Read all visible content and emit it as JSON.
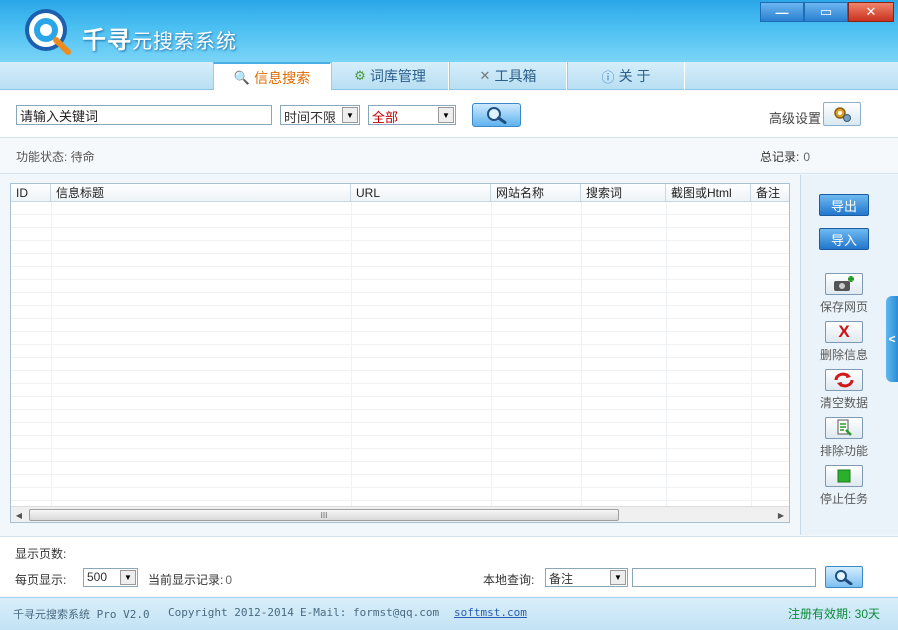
{
  "app": {
    "title_main": "千寻",
    "title_rest": "元搜索系统",
    "accent": "#2aa6e8"
  },
  "window_controls": {
    "minimize": "—",
    "maximize": "▭",
    "close": "✕"
  },
  "tabs": [
    {
      "label": "信息搜索",
      "icon": "search-icon",
      "active": true
    },
    {
      "label": "词库管理",
      "icon": "dictionary-icon",
      "active": false
    },
    {
      "label": "工具箱",
      "icon": "tools-icon",
      "active": false
    },
    {
      "label": "关 于",
      "icon": "info-icon",
      "active": false
    }
  ],
  "search": {
    "keyword_value": "请输入关键词",
    "time_filter": "时间不限",
    "scope_filter": "全部",
    "advanced_label": "高级设置"
  },
  "status": {
    "function_status": "功能状态: 待命",
    "total_label": "总记录:",
    "total_value": "0"
  },
  "table": {
    "columns": [
      "ID",
      "信息标题",
      "URL",
      "网站名称",
      "搜索词",
      "截图或Html",
      "备注"
    ],
    "rows": [],
    "scroll_thumb_label": "III"
  },
  "side_actions": {
    "export_label": "导出",
    "import_label": "导入",
    "save_page": "保存网页",
    "delete_info": "删除信息",
    "clear_data": "清空数据",
    "exclude_func": "排除功能",
    "stop_task": "停止任务"
  },
  "bottom": {
    "pages_label": "显示页数:",
    "per_page_label": "每页显示:",
    "per_page_value": "500",
    "current_label": "当前显示记录:",
    "current_value": "0",
    "local_query_label": "本地查询:",
    "local_query_field": "备注",
    "local_query_value": ""
  },
  "footer": {
    "product": "千寻元搜索系统 Pro V2.0",
    "copyright": "Copyright 2012-2014",
    "email": "E-Mail: formst@qq.com",
    "website": "softmst.com",
    "validity": "注册有效期: 30天"
  }
}
